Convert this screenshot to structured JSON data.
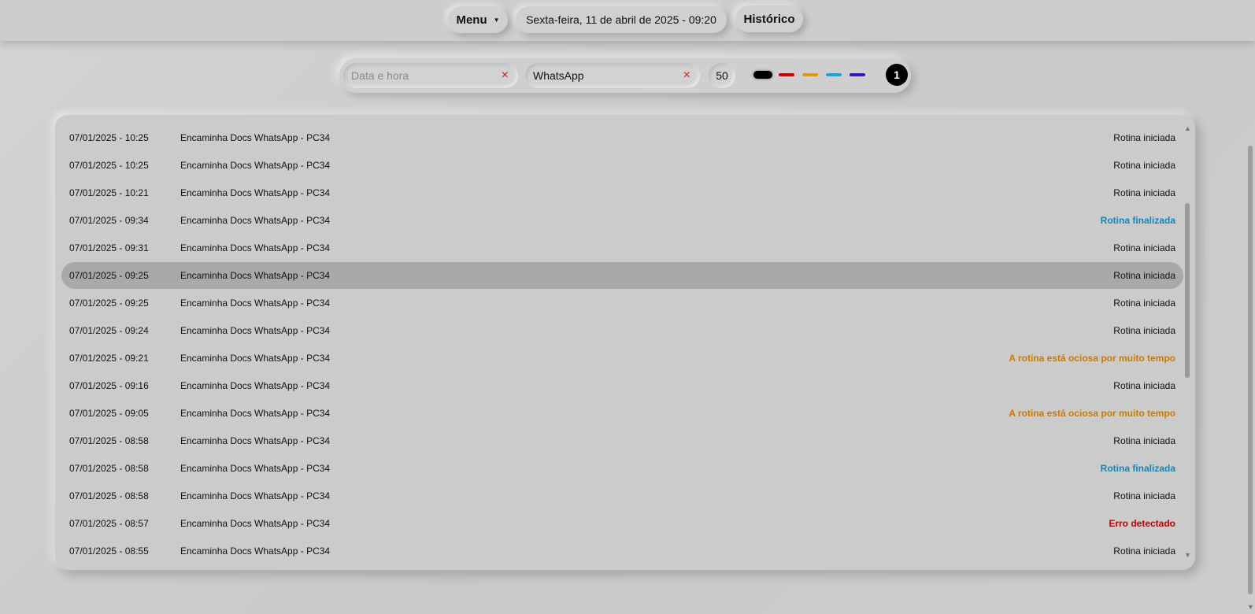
{
  "header": {
    "menu_label": "Menu",
    "date_text": "Sexta-feira, 11 de abril de 2025 - 09:20",
    "history_label": "Histórico"
  },
  "filters": {
    "datetime_placeholder": "Data e hora",
    "datetime_value": "",
    "search_value": "WhatsApp",
    "clear_icon": "×",
    "count": "50",
    "color_filters": [
      {
        "name": "black",
        "color": "#000000"
      },
      {
        "name": "red",
        "color": "#d40000"
      },
      {
        "name": "orange",
        "color": "#e09a10"
      },
      {
        "name": "cyan",
        "color": "#14a8e0"
      },
      {
        "name": "purple",
        "color": "#3a10d8"
      }
    ],
    "page": "1"
  },
  "status_colors": {
    "warn": "#c97a00",
    "done": "#1386b5",
    "err": "#c40000"
  },
  "log": {
    "rows": [
      {
        "datetime": "07/01/2025 - 10:25",
        "name": "Encaminha Docs WhatsApp - PC34",
        "status": "Rotina iniciada",
        "kind": "normal"
      },
      {
        "datetime": "07/01/2025 - 10:25",
        "name": "Encaminha Docs WhatsApp - PC34",
        "status": "Rotina iniciada",
        "kind": "normal"
      },
      {
        "datetime": "07/01/2025 - 10:21",
        "name": "Encaminha Docs WhatsApp - PC34",
        "status": "Rotina iniciada",
        "kind": "normal"
      },
      {
        "datetime": "07/01/2025 - 09:34",
        "name": "Encaminha Docs WhatsApp - PC34",
        "status": "Rotina finalizada",
        "kind": "done"
      },
      {
        "datetime": "07/01/2025 - 09:31",
        "name": "Encaminha Docs WhatsApp - PC34",
        "status": "Rotina iniciada",
        "kind": "normal"
      },
      {
        "datetime": "07/01/2025 - 09:25",
        "name": "Encaminha Docs WhatsApp - PC34",
        "status": "Rotina iniciada",
        "kind": "normal",
        "highlighted": true
      },
      {
        "datetime": "07/01/2025 - 09:25",
        "name": "Encaminha Docs WhatsApp - PC34",
        "status": "Rotina iniciada",
        "kind": "normal"
      },
      {
        "datetime": "07/01/2025 - 09:24",
        "name": "Encaminha Docs WhatsApp - PC34",
        "status": "Rotina iniciada",
        "kind": "normal"
      },
      {
        "datetime": "07/01/2025 - 09:21",
        "name": "Encaminha Docs WhatsApp - PC34",
        "status": "A rotina está ociosa por muito tempo",
        "kind": "warn"
      },
      {
        "datetime": "07/01/2025 - 09:16",
        "name": "Encaminha Docs WhatsApp - PC34",
        "status": "Rotina iniciada",
        "kind": "normal"
      },
      {
        "datetime": "07/01/2025 - 09:05",
        "name": "Encaminha Docs WhatsApp - PC34",
        "status": "A rotina está ociosa por muito tempo",
        "kind": "warn"
      },
      {
        "datetime": "07/01/2025 - 08:58",
        "name": "Encaminha Docs WhatsApp - PC34",
        "status": "Rotina iniciada",
        "kind": "normal"
      },
      {
        "datetime": "07/01/2025 - 08:58",
        "name": "Encaminha Docs WhatsApp - PC34",
        "status": "Rotina finalizada",
        "kind": "done"
      },
      {
        "datetime": "07/01/2025 - 08:58",
        "name": "Encaminha Docs WhatsApp - PC34",
        "status": "Rotina iniciada",
        "kind": "normal"
      },
      {
        "datetime": "07/01/2025 - 08:57",
        "name": "Encaminha Docs WhatsApp - PC34",
        "status": "Erro detectado",
        "kind": "err"
      },
      {
        "datetime": "07/01/2025 - 08:55",
        "name": "Encaminha Docs WhatsApp - PC34",
        "status": "Rotina iniciada",
        "kind": "normal"
      }
    ]
  },
  "icons": {
    "caret": "caret-down-icon",
    "clear": "close-icon",
    "scroll_up": "scroll-up-arrow-icon",
    "scroll_down": "scroll-down-arrow-icon"
  }
}
